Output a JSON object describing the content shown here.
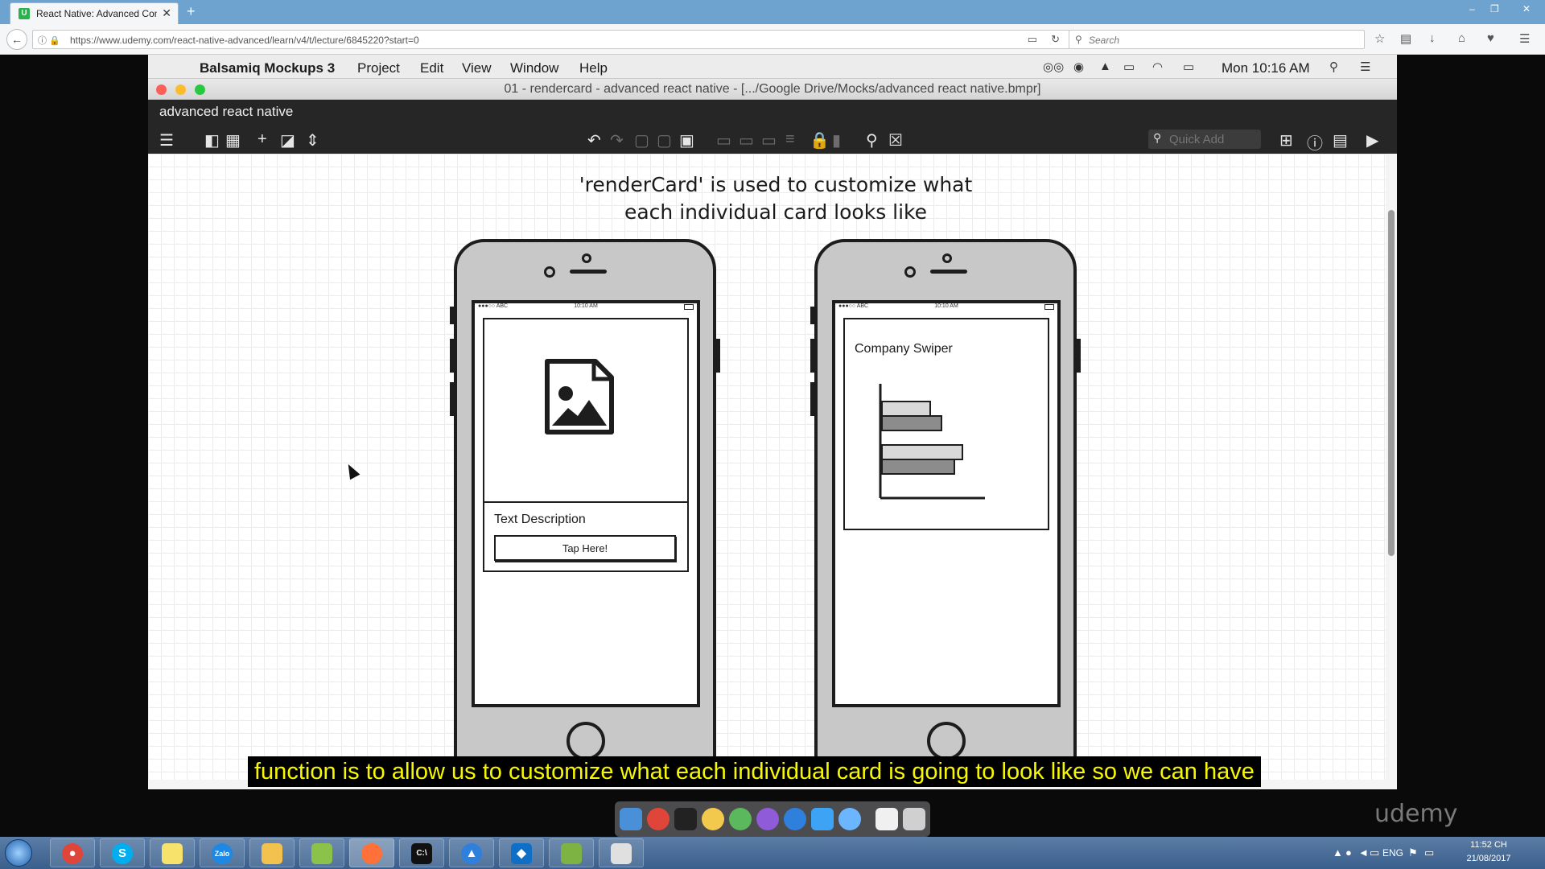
{
  "browser": {
    "tab_title": "React Native: Advanced Con",
    "tab_favicon": "U",
    "new_tab": "+",
    "url": "https://www.udemy.com/react-native-advanced/learn/v4/t/lecture/6845220?start=0",
    "search_placeholder": "Search",
    "window_controls": [
      "–",
      "❐",
      "✕"
    ]
  },
  "mac": {
    "apple": "",
    "menus": [
      "Balsamiq Mockups 3",
      "Project",
      "Edit",
      "View",
      "Window",
      "Help"
    ],
    "clock": "Mon 10:16 AM"
  },
  "window": {
    "title": "01 - rendercard - advanced react native - [.../Google Drive/Mocks/advanced react native.bmpr]",
    "project_name": "advanced react native",
    "quick_add_placeholder": "Quick Add"
  },
  "mockup": {
    "headline_line1": "'renderCard' is used to customize what",
    "headline_line2": "each individual card looks like",
    "phone1": {
      "status_signal": "●●●○○ ABC",
      "status_time": "10:10 AM",
      "card_text": "Text Description",
      "button_label": "Tap Here!"
    },
    "phone2": {
      "status_signal": "●●●○○ ABC",
      "status_time": "10:10 AM",
      "card_title": "Company Swiper"
    }
  },
  "subtitle": "function is to allow us to customize what each individual card is going to look like so we can have",
  "watermark": "udemy",
  "taskbar": {
    "language": "ENG",
    "time": "11:52 CH",
    "date": "21/08/2017"
  },
  "colors": {
    "subtitle_text": "#f7f700",
    "firefox_tabbar": "#6ea3d0",
    "balsamiq_toolbar": "#262626"
  }
}
